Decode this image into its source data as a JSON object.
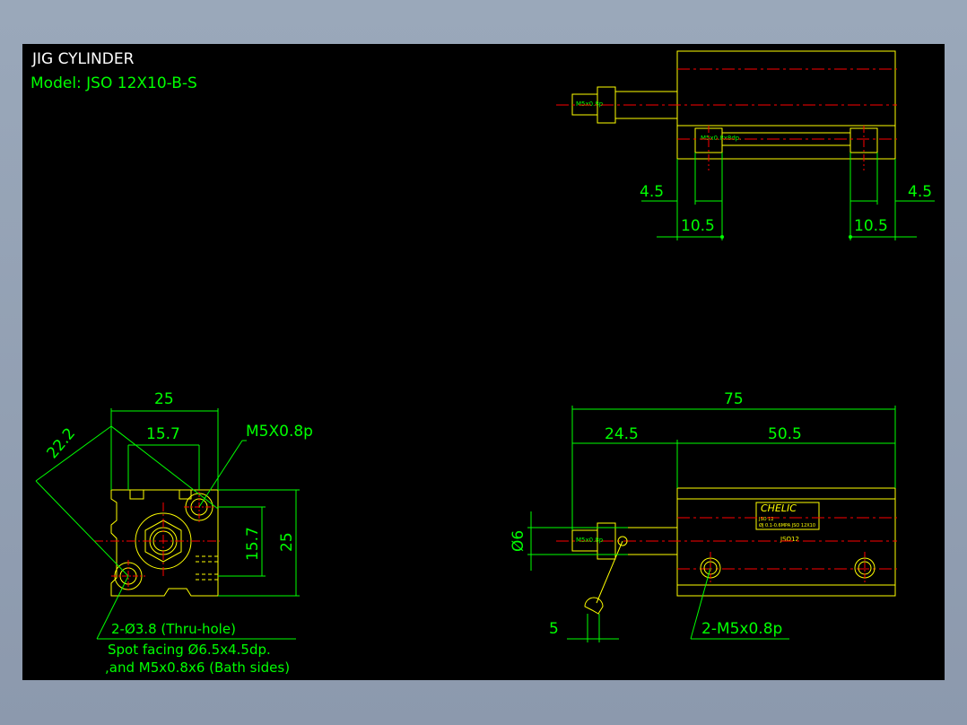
{
  "title": "JIG CYLINDER",
  "model": "Model:  JSO 12X10-B-S",
  "colors": {
    "background": "#000000",
    "outline": "#ffff00",
    "dimension": "#00ff00",
    "centerline": "#ff0000",
    "text": "#ffffff",
    "frame": "#9aa6b8"
  },
  "top_view": {
    "rod_thread": "M5x0.8p",
    "bottom_thread": "M5x0.8x8dp.",
    "dim_left_small": "4.5",
    "dim_right_small": "4.5",
    "dim_left_large": "10.5",
    "dim_right_large": "10.5"
  },
  "end_view": {
    "dim_width": "25",
    "dim_diag": "22.2",
    "dim_inner": "15.7",
    "port_label": "M5X0.8p",
    "dim_height_inner": "15.7",
    "dim_height": "25",
    "note_line1": "2-Ø3.8 (Thru-hole)",
    "note_line2": "Spot facing  Ø6.5x4.5dp.",
    "note_line3": ",and M5x0.8x6 (Bath sides)"
  },
  "side_view": {
    "dim_total": "75",
    "dim_rod": "24.5",
    "dim_body": "50.5",
    "dim_rod_dia": "Ø6",
    "dim_wrench": "5",
    "rod_thread": "M5x0.8p",
    "brand": "CHELIC",
    "label_line1": "JSO 12",
    "label_line2": "ØJ 0.1-0.6MPA  JSO 12X10",
    "model_code": "JSO12",
    "mount_label": "2-M5x0.8p"
  }
}
